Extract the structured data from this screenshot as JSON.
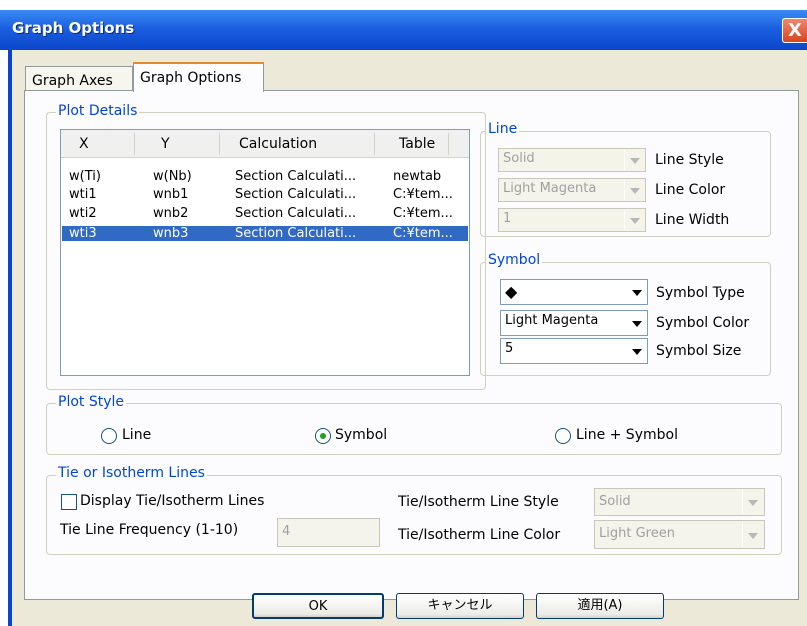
{
  "window": {
    "title": "Graph Options",
    "close": "X"
  },
  "tabs": [
    {
      "label": "Graph Axes"
    },
    {
      "label": "Graph Options"
    }
  ],
  "plot_details": {
    "legend": "Plot Details",
    "columns": [
      "X",
      "Y",
      "Calculation",
      "Table"
    ],
    "rows": [
      [
        "w(Ti)",
        "w(Nb)",
        "Section Calculati...",
        "newtab"
      ],
      [
        "wti1",
        "wnb1",
        "Section Calculati...",
        "C:¥tem..."
      ],
      [
        "wti2",
        "wnb2",
        "Section Calculati...",
        "C:¥tem..."
      ],
      [
        "wti3",
        "wnb3",
        "Section Calculati...",
        "C:¥tem..."
      ]
    ],
    "selected_row": 3
  },
  "line": {
    "legend": "Line",
    "style": {
      "value": "Solid",
      "label": "Line Style"
    },
    "color": {
      "value": "Light Magenta",
      "label": "Line Color"
    },
    "width": {
      "value": "1",
      "label": "Line Width"
    }
  },
  "symbol": {
    "legend": "Symbol",
    "type": {
      "value": "◆",
      "label": "Symbol Type"
    },
    "color": {
      "value": "Light Magenta",
      "label": "Symbol Color"
    },
    "size": {
      "value": "5",
      "label": "Symbol Size"
    }
  },
  "plot_style": {
    "legend": "Plot Style",
    "options": [
      "Line",
      "Symbol",
      "Line + Symbol"
    ],
    "selected": "Symbol"
  },
  "tie_lines": {
    "legend": "Tie or Isotherm Lines",
    "display_label": "Display Tie/Isotherm Lines",
    "display_checked": false,
    "frequency_label": "Tie Line Frequency (1-10)",
    "frequency_value": "4",
    "style_label": "Tie/Isotherm Line Style",
    "style_value": "Solid",
    "color_label": "Tie/Isotherm Line Color",
    "color_value": "Light Green"
  },
  "buttons": {
    "ok": "OK",
    "cancel": "キャンセル",
    "apply": "適用(A)"
  }
}
